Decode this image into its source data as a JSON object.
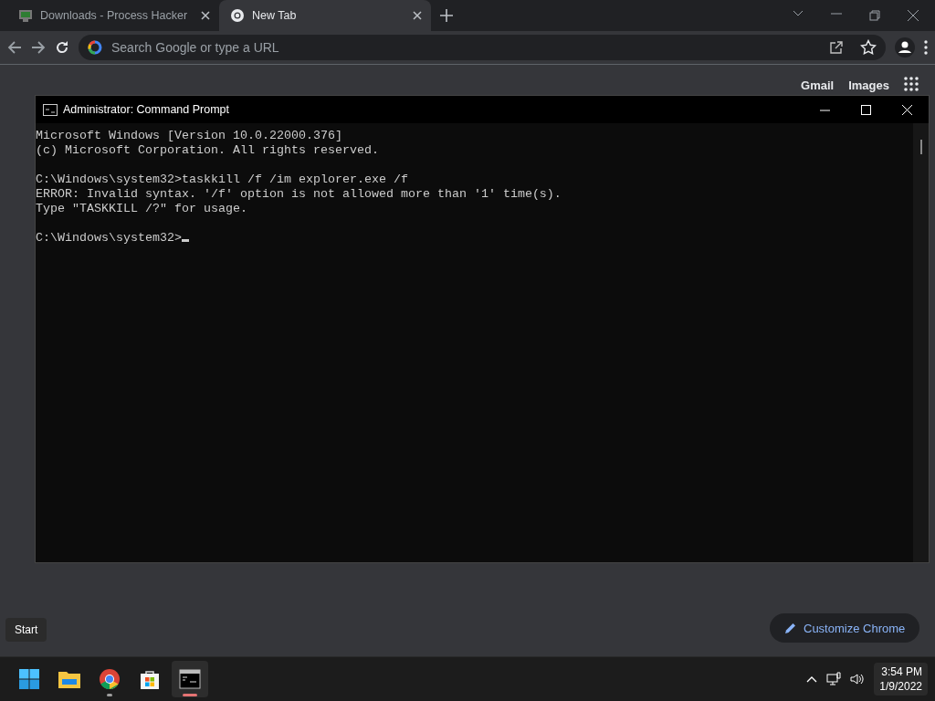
{
  "browser": {
    "tabs": [
      {
        "title": "Downloads - Process Hacker",
        "kind": "hacker",
        "selected": false
      },
      {
        "title": "New Tab",
        "kind": "chrome",
        "selected": true
      }
    ],
    "omnibox": {
      "placeholder": "Search Google or type a URL"
    },
    "links": [
      "Gmail",
      "Images"
    ],
    "customize": "Customize Chrome"
  },
  "console": {
    "title": "Administrator: Command Prompt",
    "blocks": [
      [
        "Microsoft Windows [Version 10.0.22000.376]",
        "(c) Microsoft Corporation. All rights reserved."
      ],
      [
        "C:\\Windows\\system32>taskkill /f /im explorer.exe /f",
        "ERROR: Invalid syntax. '/f' option is not allowed more than '1' time(s).",
        "Type \"TASKKILL /?\" for usage."
      ],
      [
        "C:\\Windows\\system32>"
      ]
    ]
  },
  "tooltip": "Start",
  "taskbar": {
    "apps": [
      {
        "kind": "start",
        "running": false,
        "active": false
      },
      {
        "kind": "folder",
        "running": false,
        "active": false
      },
      {
        "kind": "chrome",
        "running": true,
        "active": false
      },
      {
        "kind": "store",
        "running": false,
        "active": false
      },
      {
        "kind": "terminal",
        "running": true,
        "active": true
      }
    ],
    "time": "3:54 PM",
    "date": "1/9/2022"
  }
}
